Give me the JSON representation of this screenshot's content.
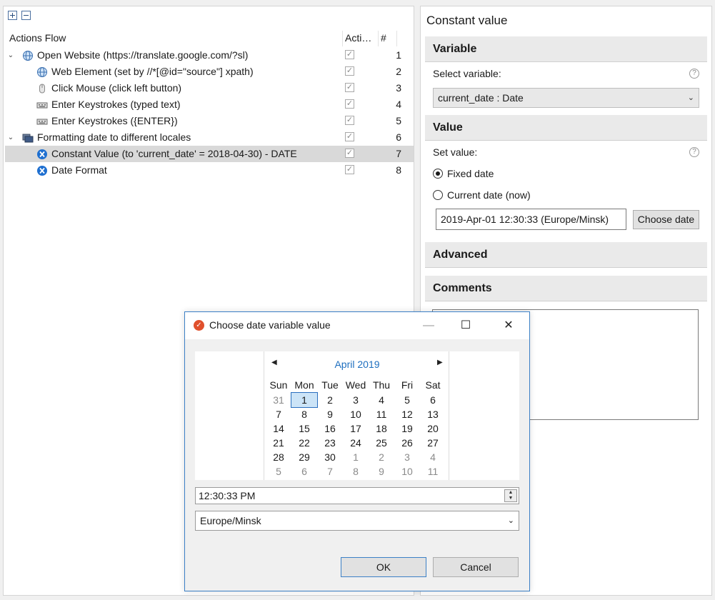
{
  "tree": {
    "header": {
      "name": "Actions Flow",
      "active": "Acti…",
      "num": "#"
    },
    "rows": [
      {
        "label": "Open Website (https://translate.google.com/?sl)",
        "num": "1",
        "icon": "globe-icon"
      },
      {
        "label": "Web Element (set by //*[@id=\"source\"] xpath)",
        "num": "2",
        "icon": "globe-icon"
      },
      {
        "label": "Click Mouse (click left button)",
        "num": "3",
        "icon": "mouse-icon"
      },
      {
        "label": "Enter Keystrokes (typed text)",
        "num": "4",
        "icon": "keyboard-icon"
      },
      {
        "label": "Enter Keystrokes ({ENTER})",
        "num": "5",
        "icon": "keyboard-icon"
      },
      {
        "label": "Formatting date to different locales",
        "num": "6",
        "icon": "folder-icon"
      },
      {
        "label": "Constant Value (to 'current_date' = 2018-04-30) - DATE",
        "num": "7",
        "icon": "variable-icon"
      },
      {
        "label": "Date Format",
        "num": "8",
        "icon": "variable-icon"
      }
    ],
    "check_mark": "✓",
    "expand_symbol": "⌄"
  },
  "panel": {
    "title": "Constant value",
    "variable": {
      "heading": "Variable",
      "select_label": "Select variable:",
      "selected": "current_date : Date",
      "help": "?"
    },
    "value": {
      "heading": "Value",
      "set_label": "Set value:",
      "help": "?",
      "options": [
        "Fixed date",
        "Current date (now)"
      ],
      "selected_option": "Fixed date",
      "date_text": "2019-Apr-01 12:30:33 (Europe/Minsk)",
      "choose_button": "Choose date"
    },
    "advanced_heading": "Advanced",
    "comments_heading": "Comments"
  },
  "dialog": {
    "title": "Choose date variable value",
    "app_icon": "✓",
    "controls": {
      "minimize": "—",
      "maximize": "☐",
      "close": "✕"
    },
    "calendar": {
      "month": "April 2019",
      "prev": "◀",
      "next": "▶",
      "weekdays": [
        "Sun",
        "Mon",
        "Tue",
        "Wed",
        "Thu",
        "Fri",
        "Sat"
      ],
      "weeks": [
        [
          "31",
          "1",
          "2",
          "3",
          "4",
          "5",
          "6"
        ],
        [
          "7",
          "8",
          "9",
          "10",
          "11",
          "12",
          "13"
        ],
        [
          "14",
          "15",
          "16",
          "17",
          "18",
          "19",
          "20"
        ],
        [
          "21",
          "22",
          "23",
          "24",
          "25",
          "26",
          "27"
        ],
        [
          "28",
          "29",
          "30",
          "1",
          "2",
          "3",
          "4"
        ],
        [
          "5",
          "6",
          "7",
          "8",
          "9",
          "10",
          "11"
        ]
      ],
      "selected_day": "1"
    },
    "time": "12:30:33 PM",
    "timezone": "Europe/Minsk",
    "ok": "OK",
    "cancel": "Cancel"
  }
}
